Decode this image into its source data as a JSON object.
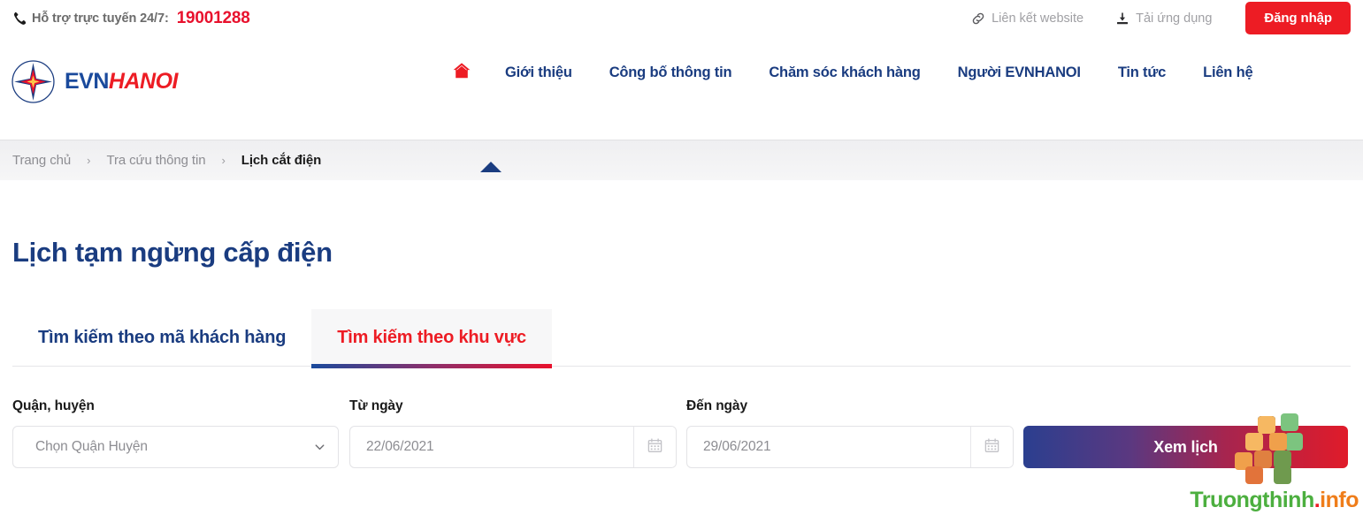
{
  "topbar": {
    "phone_icon": "phone-icon",
    "support_label": "Hỗ trợ trực tuyến 24/7:",
    "support_number": "19001288",
    "links": [
      {
        "label": "Liên kết website",
        "icon": "link-icon"
      },
      {
        "label": "Tải ứng dụng",
        "icon": "download-icon"
      }
    ],
    "login_label": "Đăng nhập"
  },
  "brand": {
    "logo_icon": "evn-star-logo-icon",
    "name_primary": "EVN",
    "name_secondary": "HANOI",
    "color_primary": "#1a4a9c",
    "color_secondary": "#ed1c24"
  },
  "nav": {
    "home_icon": "home-icon",
    "items": [
      {
        "label": "Giới thiệu"
      },
      {
        "label": "Công bố thông tin"
      },
      {
        "label": "Chăm sóc khách hàng"
      },
      {
        "label": "Người EVNHANOI"
      },
      {
        "label": "Tin tức"
      },
      {
        "label": "Liên hệ"
      }
    ],
    "active_index": -1,
    "accent_color": "#1a3c80"
  },
  "breadcrumb": {
    "separator": "›",
    "items": [
      {
        "label": "Trang chủ",
        "current": false
      },
      {
        "label": "Tra cứu thông tin",
        "current": false
      },
      {
        "label": "Lịch cắt điện",
        "current": true
      }
    ]
  },
  "main": {
    "page_title": "Lịch tạm ngừng cấp điện",
    "tabs": [
      {
        "label": "Tìm kiếm theo mã khách hàng",
        "active": false
      },
      {
        "label": "Tìm kiếm theo khu vực",
        "active": true
      }
    ],
    "form": {
      "district": {
        "label": "Quận, huyện",
        "value": "Chọn Quận Huyện",
        "chevron_icon": "chevron-down-icon"
      },
      "date_from": {
        "label": "Từ ngày",
        "value": "22/06/2021",
        "placeholder": "22/06/2021",
        "calendar_icon": "calendar-icon"
      },
      "date_to": {
        "label": "Đến ngày",
        "value": "29/06/2021",
        "placeholder": "29/06/2021",
        "calendar_icon": "calendar-icon"
      },
      "submit_label": "Xem lịch",
      "submit_gradient_from": "#2b3f8f",
      "submit_gradient_to": "#e01b2a"
    }
  },
  "watermark": {
    "text_main": "Truongthinh",
    "text_dot": ".",
    "text_tld": "info",
    "squares_icon": "checkered-squares-icon"
  }
}
